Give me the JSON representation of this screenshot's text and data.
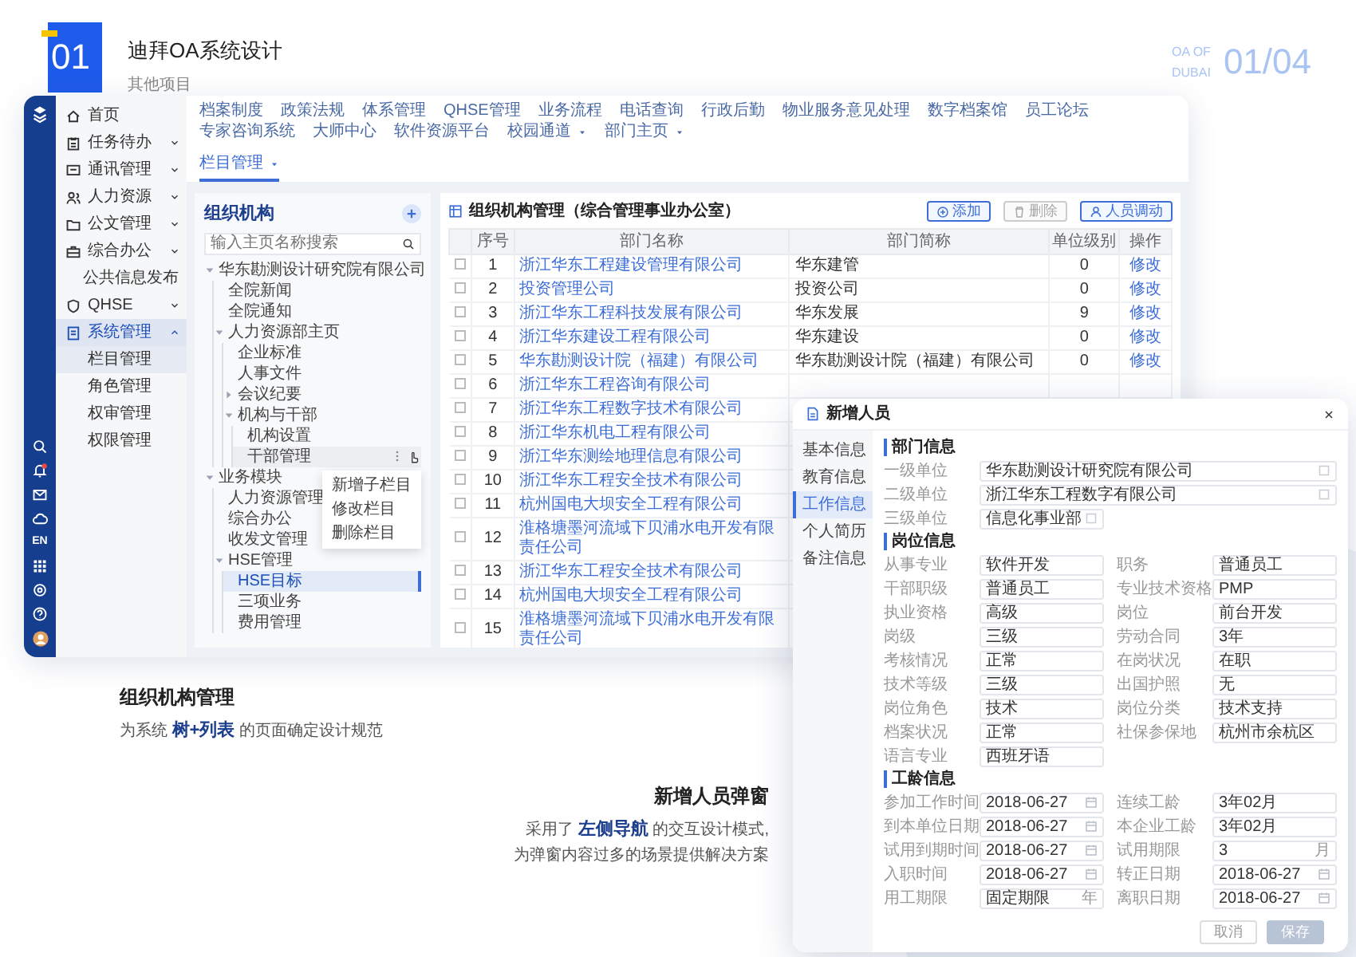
{
  "header": {
    "number": "01",
    "title": "迪拜OA系统设计",
    "subtitle": "其他项目",
    "tag_lines": [
      "OA OF",
      "DUBAI"
    ],
    "page": "01/04"
  },
  "app": {
    "rail": {
      "lang": "EN",
      "notification": true
    },
    "sidebar": [
      {
        "label": "首页",
        "kind": "icon",
        "selected": false
      },
      {
        "label": "任务待办",
        "kind": "icon",
        "expanded": false,
        "selected": false
      },
      {
        "label": "通讯管理",
        "kind": "icon",
        "expanded": false,
        "selected": false
      },
      {
        "label": "人力资源",
        "kind": "icon",
        "expanded": false,
        "selected": false
      },
      {
        "label": "公文管理",
        "kind": "icon",
        "expanded": false,
        "selected": false
      },
      {
        "label": "综合办公",
        "kind": "icon",
        "expanded": false,
        "selected": false
      },
      {
        "label": "公共信息发布",
        "kind": "plain",
        "selected": false
      },
      {
        "label": "QHSE",
        "kind": "icon",
        "expanded": false,
        "selected": false
      },
      {
        "label": "系统管理",
        "kind": "icon",
        "expanded": true,
        "selected": true,
        "children": [
          {
            "label": "栏目管理",
            "selected": true
          },
          {
            "label": "角色管理",
            "selected": false
          },
          {
            "label": "权审管理",
            "selected": false
          },
          {
            "label": "权限管理",
            "selected": false
          }
        ]
      }
    ],
    "nav": {
      "items": [
        {
          "label": "档案制度",
          "dropdown": false
        },
        {
          "label": "政策法规",
          "dropdown": false
        },
        {
          "label": "体系管理",
          "dropdown": false
        },
        {
          "label": "QHSE管理",
          "dropdown": false
        },
        {
          "label": "业务流程",
          "dropdown": false
        },
        {
          "label": "电话查询",
          "dropdown": false
        },
        {
          "label": "行政后勤",
          "dropdown": false
        },
        {
          "label": "物业服务意见处理",
          "dropdown": false
        },
        {
          "label": "数字档案馆",
          "dropdown": false
        },
        {
          "label": "员工论坛",
          "dropdown": false
        },
        {
          "label": "专家咨询系统",
          "dropdown": false
        },
        {
          "label": "大师中心",
          "dropdown": false
        },
        {
          "label": "软件资源平台",
          "dropdown": false
        },
        {
          "label": "校园通道",
          "dropdown": true
        },
        {
          "label": "部门主页",
          "dropdown": true
        }
      ],
      "subtabs": [
        {
          "label": "栏目管理",
          "selected": true
        }
      ]
    },
    "tree": {
      "title": "组织机构",
      "search_placeholder": "输入主页名称搜索",
      "nodes": [
        {
          "label": "华东勘测设计研究院有限公司",
          "expanded": true,
          "selected": false,
          "children": [
            {
              "label": "全院新闻",
              "selected": false
            },
            {
              "label": "全院通知",
              "selected": false
            },
            {
              "label": "人力资源部主页",
              "expanded": true,
              "selected": false,
              "children": [
                {
                  "label": "企业标准",
                  "selected": false
                },
                {
                  "label": "人事文件",
                  "selected": false
                },
                {
                  "label": "会议纪要",
                  "expanded": false,
                  "selected": false
                },
                {
                  "label": "机构与干部",
                  "expanded": true,
                  "selected": false,
                  "children": [
                    {
                      "label": "机构设置",
                      "selected": false
                    },
                    {
                      "label": "干部管理",
                      "selected": false,
                      "menu": [
                        "新增子栏目",
                        "修改栏目",
                        "删除栏目"
                      ]
                    }
                  ]
                }
              ]
            }
          ]
        },
        {
          "label": "业务模块",
          "expanded": true,
          "selected": false,
          "children": [
            {
              "label": "人力资源管理",
              "selected": false
            },
            {
              "label": "综合办公",
              "selected": false
            },
            {
              "label": "收发文管理",
              "selected": false
            },
            {
              "label": "HSE管理",
              "expanded": true,
              "selected": false,
              "children": [
                {
                  "label": "HSE目标",
                  "selected": true
                },
                {
                  "label": "三项业务",
                  "selected": false
                },
                {
                  "label": "费用管理",
                  "selected": false
                }
              ]
            }
          ]
        }
      ]
    },
    "table": {
      "title": "组织机构管理（综合管理事业办公室）",
      "buttons": [
        {
          "label": "添加",
          "kind": "add",
          "disabled": false
        },
        {
          "label": "删除",
          "kind": "delete",
          "disabled": true
        },
        {
          "label": "人员调动",
          "kind": "transfer",
          "disabled": false
        }
      ],
      "columns": [
        "序号",
        "部门名称",
        "部门简称",
        "单位级别",
        "操作"
      ],
      "rows": [
        {
          "checked": false,
          "cells": [
            "1",
            "浙江华东工程建设管理有限公司",
            "华东建管",
            "0",
            "修改"
          ]
        },
        {
          "checked": false,
          "cells": [
            "2",
            "投资管理公司",
            "投资公司",
            "0",
            "修改"
          ]
        },
        {
          "checked": false,
          "cells": [
            "3",
            "浙江华东工程科技发展有限公司",
            "华东发展",
            "9",
            "修改"
          ]
        },
        {
          "checked": false,
          "cells": [
            "4",
            "浙江华东建设工程有限公司",
            "华东建设",
            "0",
            "修改"
          ]
        },
        {
          "checked": false,
          "cells": [
            "5",
            "华东勘测设计院（福建）有限公司",
            "华东勘测设计院（福建）有限公司",
            "0",
            "修改"
          ]
        },
        {
          "checked": false,
          "cells": [
            "6",
            "浙江华东工程咨询有限公司"
          ]
        },
        {
          "checked": false,
          "cells": [
            "7",
            "浙江华东工程数字技术有限公司"
          ]
        },
        {
          "checked": false,
          "cells": [
            "8",
            "浙江华东机电工程有限公司"
          ]
        },
        {
          "checked": false,
          "cells": [
            "9",
            "浙江华东测绘地理信息有限公司"
          ]
        },
        {
          "checked": false,
          "cells": [
            "10",
            "浙江华东工程安全技术有限公司"
          ]
        },
        {
          "checked": false,
          "cells": [
            "11",
            "杭州国电大坝安全工程有限公司"
          ]
        },
        {
          "checked": false,
          "cells": [
            "12",
            "淮格塘墨河流域下贝浦水电开发有限责任公司"
          ]
        },
        {
          "checked": false,
          "cells": [
            "13",
            "浙江华东工程安全技术有限公司"
          ]
        },
        {
          "checked": false,
          "cells": [
            "14",
            "杭州国电大坝安全工程有限公司"
          ]
        },
        {
          "checked": false,
          "cells": [
            "15",
            "淮格塘墨河流域下贝浦水电开发有限责任公司"
          ]
        }
      ]
    }
  },
  "captions": [
    {
      "title": "组织机构管理",
      "lines": [
        "为系统 **树+列表** 的页面确定设计规范"
      ]
    },
    {
      "title": "新增人员弹窗",
      "lines": [
        "采用了 **左侧导航** 的交互设计模式,",
        "为弹窗内容过多的场景提供解决方案"
      ]
    }
  ],
  "dialog": {
    "title": "新增人员",
    "nav": [
      {
        "label": "基本信息",
        "selected": false
      },
      {
        "label": "教育信息",
        "selected": false
      },
      {
        "label": "工作信息",
        "selected": true
      },
      {
        "label": "个人简历",
        "selected": false
      },
      {
        "label": "备注信息",
        "selected": false
      }
    ],
    "sections": [
      {
        "title": "部门信息",
        "fields": [
          {
            "label": "一级单位",
            "value": "华东勘测设计研究院有限公司",
            "kind": "select",
            "wide": true
          },
          {
            "label": "二级单位",
            "value": "浙江华东工程数字有限公司",
            "kind": "select",
            "wide": true
          },
          {
            "label": "三级单位",
            "value": "信息化事业部",
            "kind": "select",
            "wide": false
          }
        ]
      },
      {
        "title": "岗位信息",
        "fields": [
          {
            "label": "从事专业",
            "value": "软件开发",
            "kind": "text"
          },
          {
            "label": "职务",
            "value": "普通员工",
            "kind": "text"
          },
          {
            "label": "干部职级",
            "value": "普通员工",
            "kind": "text"
          },
          {
            "label": "专业技术资格",
            "value": "PMP",
            "kind": "text"
          },
          {
            "label": "执业资格",
            "value": "高级",
            "kind": "text"
          },
          {
            "label": "岗位",
            "value": "前台开发",
            "kind": "text"
          },
          {
            "label": "岗级",
            "value": "三级",
            "kind": "text"
          },
          {
            "label": "劳动合同",
            "value": "3年",
            "kind": "text"
          },
          {
            "label": "考核情况",
            "value": "正常",
            "kind": "text"
          },
          {
            "label": "在岗状况",
            "value": "在职",
            "kind": "text"
          },
          {
            "label": "技术等级",
            "value": "三级",
            "kind": "text"
          },
          {
            "label": "出国护照",
            "value": "无",
            "kind": "text"
          },
          {
            "label": "岗位角色",
            "value": "技术",
            "kind": "text"
          },
          {
            "label": "岗位分类",
            "value": "技术支持",
            "kind": "text"
          },
          {
            "label": "档案状况",
            "value": "正常",
            "kind": "text"
          },
          {
            "label": "社保参保地",
            "value": "杭州市余杭区",
            "kind": "text"
          },
          {
            "label": "语言专业",
            "value": "西班牙语",
            "kind": "text"
          }
        ]
      },
      {
        "title": "工龄信息",
        "fields": [
          {
            "label": "参加工作时间",
            "value": "2018-06-27",
            "kind": "date"
          },
          {
            "label": "连续工龄",
            "value": "3年02月",
            "kind": "text"
          },
          {
            "label": "到本单位日期",
            "value": "2018-06-27",
            "kind": "date"
          },
          {
            "label": "本企业工龄",
            "value": "3年02月",
            "kind": "text"
          },
          {
            "label": "试用到期时间",
            "value": "2018-06-27",
            "kind": "date"
          },
          {
            "label": "试用期限",
            "value": "3",
            "kind": "suffix",
            "suffix": "月"
          },
          {
            "label": "入职时间",
            "value": "2018-06-27",
            "kind": "date"
          },
          {
            "label": "转正日期",
            "value": "2018-06-27",
            "kind": "date"
          },
          {
            "label": "用工期限",
            "value": "固定期限",
            "kind": "suffix",
            "suffix": "年"
          },
          {
            "label": "离职日期",
            "value": "2018-06-27",
            "kind": "date"
          }
        ]
      }
    ],
    "buttons": [
      {
        "label": "取消",
        "kind": "secondary"
      },
      {
        "label": "保存",
        "kind": "primary"
      }
    ]
  }
}
